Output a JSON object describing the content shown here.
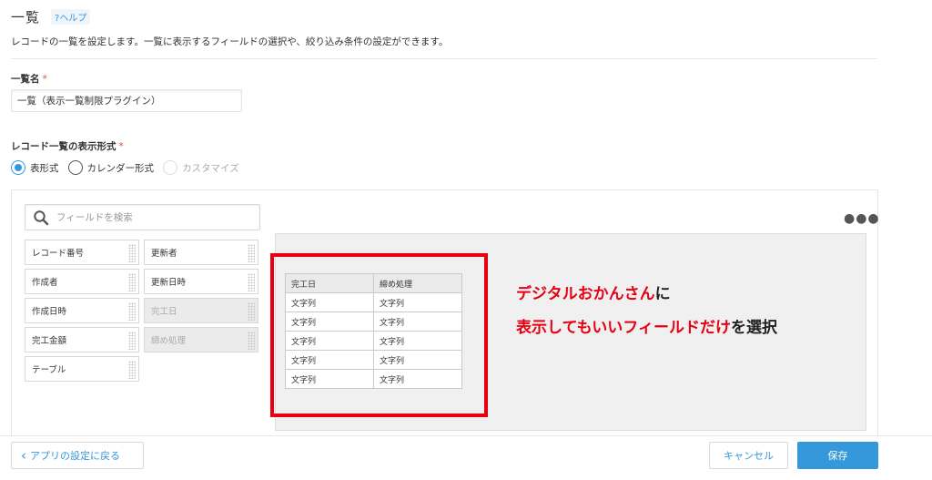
{
  "header": {
    "title": "一覧",
    "help_label": "?ヘルプ",
    "description": "レコードの一覧を設定します。一覧に表示するフィールドの選択や、絞り込み条件の設定ができます。"
  },
  "list_name": {
    "label": "一覧名",
    "required_mark": "*",
    "value": "一覧（表示一覧制限プラグイン）"
  },
  "display_format": {
    "label": "レコード一覧の表示形式",
    "required_mark": "*",
    "options": [
      {
        "label": "表形式",
        "checked": true,
        "disabled": false
      },
      {
        "label": "カレンダー形式",
        "checked": false,
        "disabled": false
      },
      {
        "label": "カスタマイズ",
        "checked": false,
        "disabled": true
      }
    ]
  },
  "field_search": {
    "placeholder": "フィールドを検索"
  },
  "fields": {
    "left": [
      "レコード番号",
      "作成者",
      "作成日時",
      "完工金額",
      "テーブル"
    ],
    "right": [
      "更新者",
      "更新日時",
      "完工日",
      "締め処理"
    ],
    "right_used": [
      false,
      false,
      true,
      true
    ]
  },
  "menu_icon": "more-dots-icon",
  "preview": {
    "headers": [
      "完工日",
      "締め処理"
    ],
    "rows": [
      [
        "文字列",
        "文字列"
      ],
      [
        "文字列",
        "文字列"
      ],
      [
        "文字列",
        "文字列"
      ],
      [
        "文字列",
        "文字列"
      ],
      [
        "文字列",
        "文字列"
      ]
    ]
  },
  "annotation": {
    "line1_red": "デジタルおかんさん",
    "line1_black": "に",
    "line2_red": "表示してもいいフィールドだけ",
    "line2_black": "を選択"
  },
  "footer": {
    "back_label": "アプリの設定に戻る",
    "cancel_label": "キャンセル",
    "save_label": "保存"
  },
  "colors": {
    "accent": "#3498db",
    "required": "#e74c3c",
    "highlight": "#e60012"
  }
}
